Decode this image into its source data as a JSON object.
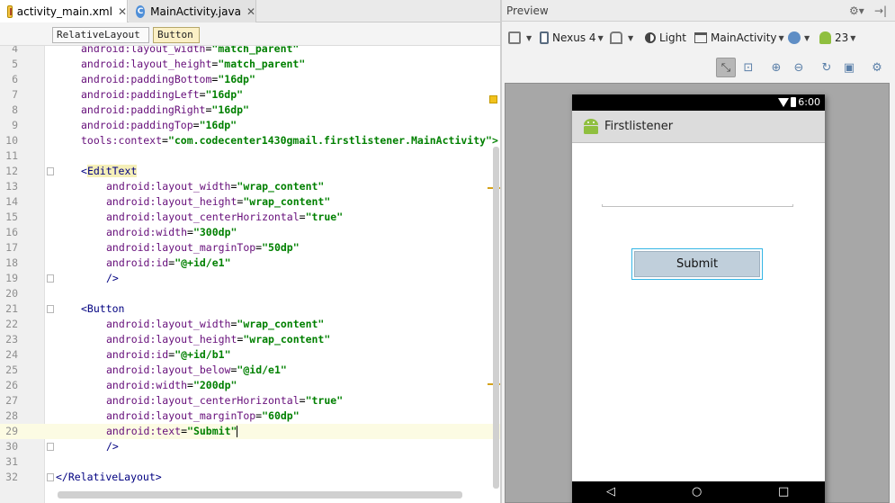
{
  "tabs": [
    {
      "label": "activity_main.xml",
      "icon": "xml-file-icon",
      "active": true
    },
    {
      "label": "MainActivity.java",
      "icon": "java-class-icon",
      "icon_letter": "C",
      "active": false
    }
  ],
  "breadcrumb": [
    "RelativeLayout",
    "Button"
  ],
  "editor": {
    "lines": [
      {
        "n": "4",
        "indent": 4,
        "attr": "android:layout_width",
        "val": "\"match_parent\""
      },
      {
        "n": "5",
        "indent": 4,
        "attr": "android:layout_height",
        "val": "\"match_parent\""
      },
      {
        "n": "6",
        "indent": 4,
        "attr": "android:paddingBottom",
        "val": "\"16dp\""
      },
      {
        "n": "7",
        "indent": 4,
        "attr": "android:paddingLeft",
        "val": "\"16dp\""
      },
      {
        "n": "8",
        "indent": 4,
        "attr": "android:paddingRight",
        "val": "\"16dp\""
      },
      {
        "n": "9",
        "indent": 4,
        "attr": "android:paddingTop",
        "val": "\"16dp\""
      },
      {
        "n": "10",
        "indent": 4,
        "attr": "tools:context",
        "val": "\"com.codecenter1430gmail.firstlistener.MainActivity\">"
      },
      {
        "n": "11"
      },
      {
        "n": "12",
        "indent": 4,
        "tag": "<EditText",
        "fold": true
      },
      {
        "n": "13",
        "indent": 8,
        "attr": "android:layout_width",
        "val": "\"wrap_content\""
      },
      {
        "n": "14",
        "indent": 8,
        "attr": "android:layout_height",
        "val": "\"wrap_content\""
      },
      {
        "n": "15",
        "indent": 8,
        "attr": "android:layout_centerHorizontal",
        "val": "\"true\""
      },
      {
        "n": "16",
        "indent": 8,
        "attr": "android:width",
        "val": "\"300dp\""
      },
      {
        "n": "17",
        "indent": 8,
        "attr": "android:layout_marginTop",
        "val": "\"50dp\""
      },
      {
        "n": "18",
        "indent": 8,
        "attr": "android:id",
        "val": "\"@+id/e1\""
      },
      {
        "n": "19",
        "indent": 8,
        "tag": "/>",
        "fold": true
      },
      {
        "n": "20"
      },
      {
        "n": "21",
        "indent": 4,
        "tag": "<Button",
        "fold": true
      },
      {
        "n": "22",
        "indent": 8,
        "attr": "android:layout_width",
        "val": "\"wrap_content\""
      },
      {
        "n": "23",
        "indent": 8,
        "attr": "android:layout_height",
        "val": "\"wrap_content\""
      },
      {
        "n": "24",
        "indent": 8,
        "attr": "android:id",
        "val": "\"@+id/b1\""
      },
      {
        "n": "25",
        "indent": 8,
        "attr": "android:layout_below",
        "val": "\"@id/e1\""
      },
      {
        "n": "26",
        "indent": 8,
        "attr": "android:width",
        "val": "\"200dp\""
      },
      {
        "n": "27",
        "indent": 8,
        "attr": "android:layout_centerHorizontal",
        "val": "\"true\""
      },
      {
        "n": "28",
        "indent": 8,
        "attr": "android:layout_marginTop",
        "val": "\"60dp\""
      },
      {
        "n": "29",
        "indent": 8,
        "attr": "android:text",
        "val": "\"Submit\"",
        "current": true
      },
      {
        "n": "30",
        "indent": 8,
        "tag": "/>",
        "fold": true
      },
      {
        "n": "31"
      },
      {
        "n": "32",
        "indent": 0,
        "tag": "</RelativeLayout>",
        "fold": true
      }
    ]
  },
  "preview": {
    "title": "Preview",
    "device": "Nexus 4",
    "theme": "Light",
    "activity": "MainActivity",
    "api_level": "23",
    "app": {
      "status_time": "6:00",
      "title": "Firstlistener",
      "button_label": "Submit"
    }
  },
  "colors": {
    "tag": "#000080",
    "attr": "#660e7a",
    "value": "#008000",
    "current_line": "#fcfbe3",
    "button_fill": "#c0cfdb",
    "button_border": "#33b5e5",
    "android_green": "#8fbf3f"
  }
}
